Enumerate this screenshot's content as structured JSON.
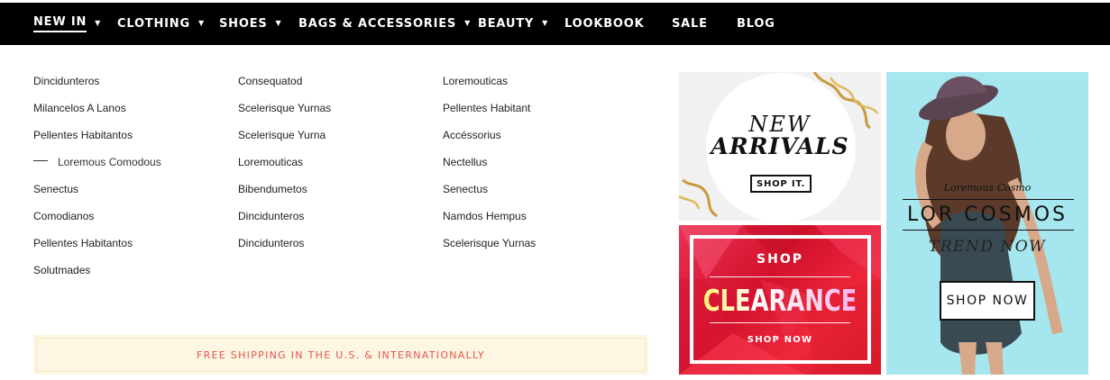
{
  "nav": {
    "items": [
      {
        "label": "NEW IN",
        "has_dropdown": true,
        "active": true
      },
      {
        "label": "CLOTHING",
        "has_dropdown": true
      },
      {
        "label": "SHOES",
        "has_dropdown": true
      },
      {
        "label": "BAGS & ACCESSORIES",
        "has_dropdown": true
      },
      {
        "label": "BEAUTY",
        "has_dropdown": true
      },
      {
        "label": "LOOKBOOK",
        "has_dropdown": false
      },
      {
        "label": "SALE",
        "has_dropdown": false
      },
      {
        "label": "BLOG",
        "has_dropdown": false
      }
    ],
    "caret": "▼"
  },
  "menu": {
    "col1": [
      "Dincidunteros",
      "Milancelos A Lanos",
      "Pellentes Habitantos",
      "Loremous Comodous",
      "Senectus",
      "Comodianos",
      "Pellentes Habitantos",
      "Solutmades"
    ],
    "col2": [
      "Consequatod",
      "Scelerisque Yurnas",
      "Scelerisque Yurna",
      "Loremouticas",
      "Bibendumetos",
      "Dincidunteros",
      "Dincidunteros"
    ],
    "col3": [
      "Loremouticas",
      "Pellentes Habitant",
      "Accéssorius",
      "Nectellus",
      "Senectus",
      "Namdos Hempus",
      "Scelerisque Yurnas"
    ]
  },
  "shipping": {
    "text": "FREE SHIPPING IN THE U.S. & INTERNATIONALLY"
  },
  "banners": {
    "new_arrivals": {
      "line1": "NEW",
      "line2": "ARRIVALS",
      "button": "SHOP IT."
    },
    "clearance": {
      "line1": "SHOP",
      "line2": "CLEARANCE",
      "button": "SHOP NOW"
    },
    "cosmos": {
      "small": "Loremous Cosmo",
      "big": "LOR COSMOS",
      "trend": "TREND NOW",
      "button": "SHOP NOW"
    }
  },
  "colors": {
    "nav_bg": "#000000",
    "shipping_text": "#e2574c",
    "shipping_bg": "#fdf6e3",
    "cosmo_bg": "#a6e7ef",
    "clearance_red": "#d3122c"
  }
}
